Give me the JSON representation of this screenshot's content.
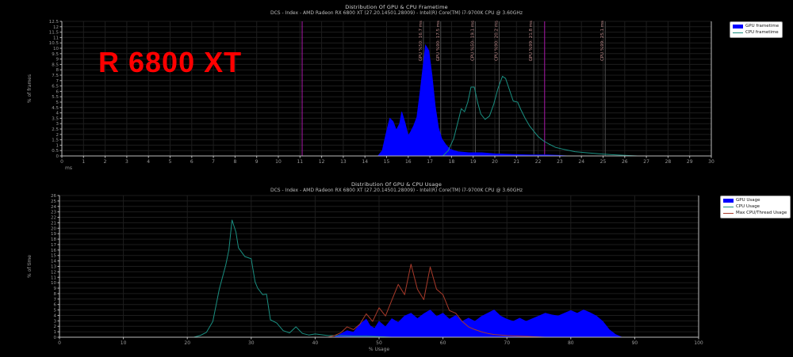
{
  "page": {
    "background": "#000000"
  },
  "colors": {
    "gpu_blue": "#0000ff",
    "cpu_teal": "#1a8f81",
    "max_thread_red": "#a93a2a",
    "marker_magenta": "#a819a8",
    "marker_gray": "#4f4f4f",
    "marker_label": "#c08d8d",
    "annotation_red": "#ff0000",
    "grid": "#1d1d1d",
    "axis": "#bbbbbb",
    "tick_text": "#9b9b9b"
  },
  "chart_data": [
    {
      "type": "area",
      "title": "Distribution Of GPU & CPU Frametime",
      "subtitle": "DCS - Index - AMD Radeon RX 6800 XT (27.20.14501.28009) - Intel(R) Core(TM) i7-9700K CPU @ 3.60GHz",
      "xlabel": "ms",
      "ylabel": "% of frames",
      "xlim": [
        0,
        30
      ],
      "xtick_step": 1,
      "ylim": [
        0,
        12.5
      ],
      "ytick_step": 0.5,
      "grid": true,
      "legend_position": "top-right-outside",
      "annotation": {
        "text": "R 6800 XT",
        "color": "#ff0000"
      },
      "series": [
        {
          "name": "GPU frametime",
          "style": "area",
          "color": "#0000ff",
          "points": [
            [
              14.6,
              0
            ],
            [
              14.8,
              0.5
            ],
            [
              15.0,
              2.3
            ],
            [
              15.15,
              3.5
            ],
            [
              15.3,
              3.2
            ],
            [
              15.45,
              2.4
            ],
            [
              15.6,
              3.0
            ],
            [
              15.7,
              4.1
            ],
            [
              15.85,
              3.1
            ],
            [
              16.0,
              1.9
            ],
            [
              16.1,
              2.2
            ],
            [
              16.25,
              2.8
            ],
            [
              16.4,
              3.6
            ],
            [
              16.55,
              6.0
            ],
            [
              16.7,
              8.6
            ],
            [
              16.8,
              10.3
            ],
            [
              16.95,
              9.8
            ],
            [
              17.1,
              7.5
            ],
            [
              17.25,
              4.6
            ],
            [
              17.4,
              2.6
            ],
            [
              17.55,
              1.6
            ],
            [
              17.75,
              1.0
            ],
            [
              17.95,
              0.6
            ],
            [
              18.3,
              0.4
            ],
            [
              18.8,
              0.3
            ],
            [
              19.4,
              0.3
            ],
            [
              20.0,
              0.2
            ],
            [
              20.8,
              0.15
            ],
            [
              21.6,
              0.1
            ],
            [
              22.4,
              0.1
            ],
            [
              23.0,
              0.05
            ],
            [
              23.4,
              0
            ]
          ]
        },
        {
          "name": "CPU frametime",
          "style": "line",
          "color": "#1a8f81",
          "points": [
            [
              17.6,
              0
            ],
            [
              17.85,
              0.5
            ],
            [
              18.1,
              1.6
            ],
            [
              18.3,
              3.2
            ],
            [
              18.45,
              4.4
            ],
            [
              18.6,
              4.1
            ],
            [
              18.75,
              5.0
            ],
            [
              18.9,
              6.4
            ],
            [
              19.05,
              6.4
            ],
            [
              19.2,
              5.0
            ],
            [
              19.35,
              3.9
            ],
            [
              19.55,
              3.4
            ],
            [
              19.75,
              3.7
            ],
            [
              19.95,
              4.8
            ],
            [
              20.15,
              6.3
            ],
            [
              20.35,
              7.4
            ],
            [
              20.5,
              7.2
            ],
            [
              20.65,
              6.3
            ],
            [
              20.85,
              5.1
            ],
            [
              21.05,
              5.0
            ],
            [
              21.2,
              4.3
            ],
            [
              21.4,
              3.5
            ],
            [
              21.6,
              2.8
            ],
            [
              21.8,
              2.3
            ],
            [
              22.0,
              1.8
            ],
            [
              22.25,
              1.4
            ],
            [
              22.5,
              1.1
            ],
            [
              22.8,
              0.8
            ],
            [
              23.2,
              0.6
            ],
            [
              23.7,
              0.4
            ],
            [
              24.2,
              0.3
            ],
            [
              24.8,
              0.2
            ],
            [
              25.4,
              0.12
            ],
            [
              26.0,
              0.06
            ],
            [
              26.6,
              0
            ]
          ]
        }
      ],
      "markers": [
        {
          "x": 11.1,
          "color": "#a819a8",
          "label": ""
        },
        {
          "x": 16.7,
          "color": "#4f4f4f",
          "label": "GPU %50: 16.7 ms"
        },
        {
          "x": 17.5,
          "color": "#4f4f4f",
          "label": "GPU %90: 17.5 ms"
        },
        {
          "x": 19.1,
          "color": "#4f4f4f",
          "label": "CPU %50: 19.1 ms"
        },
        {
          "x": 20.2,
          "color": "#4f4f4f",
          "label": "CPU %90: 20.2 ms"
        },
        {
          "x": 21.8,
          "color": "#4f4f4f",
          "label": "GPU %99: 21.8 ms"
        },
        {
          "x": 22.3,
          "color": "#a819a8",
          "label": ""
        },
        {
          "x": 25.1,
          "color": "#4f4f4f",
          "label": "CPU %99: 25.1 ms"
        }
      ]
    },
    {
      "type": "area",
      "title": "Distribution Of GPU & CPU Usage",
      "subtitle": "DCS - Index - AMD Radeon RX 6800 XT (27.20.14501.28009) - Intel(R) Core(TM) i7-9700K CPU @ 3.60GHz",
      "xlabel": "% Usage",
      "ylabel": "% of time",
      "xlim": [
        0,
        100
      ],
      "xtick_step": 10,
      "ylim": [
        0,
        26
      ],
      "ytick_step": 1,
      "grid": true,
      "legend_position": "top-right-outside",
      "series": [
        {
          "name": "GPU Usage",
          "style": "area",
          "color": "#0000ff",
          "points": [
            [
              43,
              0
            ],
            [
              44,
              0.6
            ],
            [
              45,
              1.2
            ],
            [
              46,
              0.9
            ],
            [
              47,
              2.4
            ],
            [
              48,
              3.3
            ],
            [
              48.6,
              2.1
            ],
            [
              49.3,
              1.6
            ],
            [
              50,
              2.9
            ],
            [
              51,
              1.9
            ],
            [
              52,
              3.4
            ],
            [
              53,
              2.7
            ],
            [
              54,
              3.9
            ],
            [
              55,
              4.4
            ],
            [
              56,
              3.4
            ],
            [
              57,
              4.3
            ],
            [
              58,
              5.0
            ],
            [
              59,
              3.8
            ],
            [
              60,
              4.4
            ],
            [
              61,
              3.3
            ],
            [
              62,
              4.0
            ],
            [
              63,
              2.9
            ],
            [
              64,
              3.5
            ],
            [
              65,
              2.9
            ],
            [
              66,
              3.8
            ],
            [
              67,
              4.4
            ],
            [
              68,
              5.0
            ],
            [
              69,
              3.9
            ],
            [
              70,
              3.3
            ],
            [
              71,
              2.9
            ],
            [
              72,
              3.5
            ],
            [
              73,
              2.9
            ],
            [
              74,
              3.4
            ],
            [
              75,
              3.9
            ],
            [
              76,
              4.4
            ],
            [
              77,
              4.1
            ],
            [
              78,
              3.9
            ],
            [
              79,
              4.4
            ],
            [
              80,
              4.9
            ],
            [
              81,
              4.4
            ],
            [
              82,
              5.0
            ],
            [
              83,
              4.5
            ],
            [
              84,
              3.9
            ],
            [
              85,
              2.9
            ],
            [
              86,
              1.4
            ],
            [
              87,
              0.5
            ],
            [
              88,
              0
            ]
          ]
        },
        {
          "name": "CPU Usage",
          "style": "line",
          "color": "#1a8f81",
          "points": [
            [
              21,
              0
            ],
            [
              22,
              0.3
            ],
            [
              23,
              0.9
            ],
            [
              24,
              2.9
            ],
            [
              25,
              8.8
            ],
            [
              26,
              13.2
            ],
            [
              26.5,
              16.0
            ],
            [
              27,
              21.5
            ],
            [
              27.6,
              19.3
            ],
            [
              28,
              16.4
            ],
            [
              29,
              14.8
            ],
            [
              30,
              14.4
            ],
            [
              30.6,
              10.2
            ],
            [
              31,
              9.0
            ],
            [
              31.8,
              7.8
            ],
            [
              32.4,
              7.9
            ],
            [
              33,
              3.2
            ],
            [
              34,
              2.6
            ],
            [
              35,
              1.2
            ],
            [
              36,
              0.8
            ],
            [
              37,
              1.9
            ],
            [
              38,
              0.7
            ],
            [
              39,
              0.4
            ],
            [
              40,
              0.6
            ],
            [
              42,
              0.3
            ],
            [
              44,
              0.3
            ],
            [
              46,
              0.2
            ],
            [
              48,
              0.2
            ],
            [
              50,
              0.1
            ],
            [
              52,
              0
            ]
          ]
        },
        {
          "name": "Max CPU/Thread Usage",
          "style": "line",
          "color": "#a93a2a",
          "points": [
            [
              42,
              0
            ],
            [
              43,
              0.3
            ],
            [
              44,
              0.8
            ],
            [
              45,
              1.9
            ],
            [
              46,
              1.4
            ],
            [
              47,
              2.4
            ],
            [
              48,
              4.3
            ],
            [
              49,
              2.9
            ],
            [
              50,
              5.4
            ],
            [
              51,
              3.9
            ],
            [
              52,
              6.8
            ],
            [
              53,
              9.7
            ],
            [
              54,
              7.8
            ],
            [
              55,
              13.4
            ],
            [
              56,
              8.8
            ],
            [
              57,
              6.9
            ],
            [
              58,
              12.9
            ],
            [
              59,
              8.8
            ],
            [
              60,
              7.8
            ],
            [
              61,
              4.9
            ],
            [
              62,
              4.4
            ],
            [
              63,
              2.9
            ],
            [
              64,
              1.9
            ],
            [
              65,
              1.4
            ],
            [
              66,
              1.0
            ],
            [
              67,
              0.7
            ],
            [
              68,
              0.5
            ],
            [
              70,
              0.3
            ],
            [
              72,
              0.2
            ],
            [
              74,
              0.1
            ],
            [
              76,
              0
            ]
          ]
        }
      ],
      "markers": []
    }
  ]
}
